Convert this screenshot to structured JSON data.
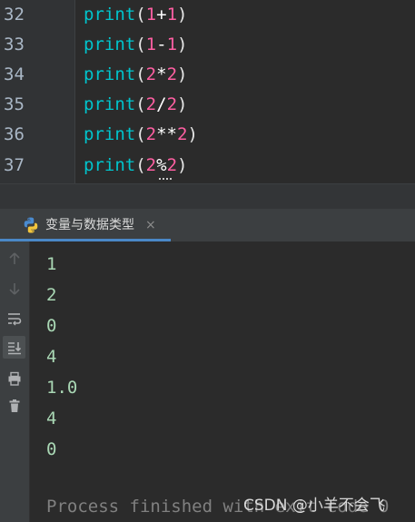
{
  "editor": {
    "lines": [
      {
        "number": "32",
        "fn": "print",
        "open": "(",
        "a": "1",
        "op": "+",
        "b": "1",
        "close": ")"
      },
      {
        "number": "33",
        "fn": "print",
        "open": "(",
        "a": "1",
        "op": "-",
        "b": "1",
        "close": ")"
      },
      {
        "number": "34",
        "fn": "print",
        "open": "(",
        "a": "2",
        "op": "*",
        "b": "2",
        "close": ")"
      },
      {
        "number": "35",
        "fn": "print",
        "open": "(",
        "a": "2",
        "op": "/",
        "b": "2",
        "close": ")"
      },
      {
        "number": "36",
        "fn": "print",
        "open": "(",
        "a": "2",
        "op": "**",
        "b": "2",
        "close": ")"
      },
      {
        "number": "37",
        "fn": "print",
        "open": "(",
        "a": "2",
        "op": "%",
        "b": "2",
        "close": ")"
      }
    ]
  },
  "run_panel": {
    "tab_label": "变量与数据类型",
    "tab_close": "×",
    "toolbar_icons": [
      "arrow-up-icon",
      "arrow-down-icon",
      "soft-wrap-icon",
      "scroll-to-end-icon",
      "print-icon",
      "trash-icon"
    ]
  },
  "console": {
    "output": [
      "1",
      "2",
      "0",
      "4",
      "1.0",
      "4",
      "0"
    ],
    "process_text": "Process finished with exit code 0"
  },
  "watermark": "CSDN @小羊不会飞",
  "colors": {
    "background": "#2b2b2b",
    "function": "#00c4cc",
    "number": "#ff5fa2",
    "output": "#a9d7b4",
    "tab_underline": "#4a88c7"
  }
}
